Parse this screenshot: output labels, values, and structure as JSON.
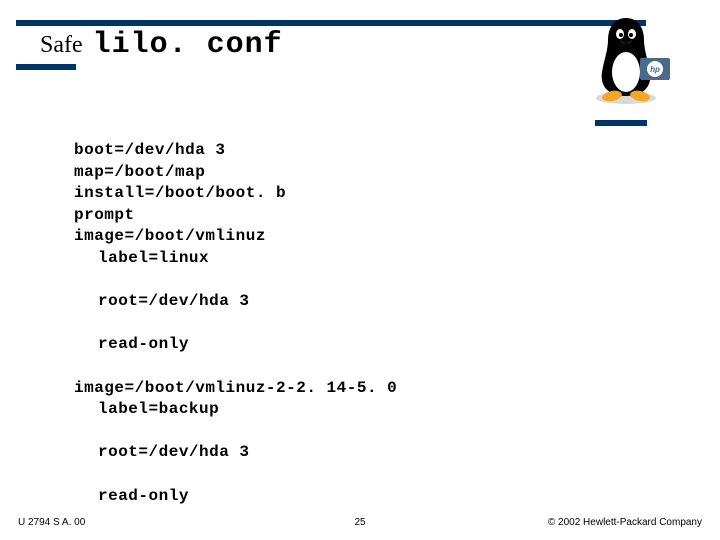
{
  "header": {
    "prefix": "Safe",
    "title": "lilo. conf"
  },
  "config": {
    "lines": [
      {
        "text": "boot=/dev/hda 3",
        "indent": false
      },
      {
        "text": "map=/boot/map",
        "indent": false
      },
      {
        "text": "install=/boot/boot. b",
        "indent": false
      },
      {
        "text": "prompt",
        "indent": false
      },
      {
        "text": "image=/boot/vmlinuz",
        "indent": false
      },
      {
        "text": "label=linux",
        "indent": true
      },
      {
        "text": "root=/dev/hda 3",
        "indent": true
      },
      {
        "text": "read-only",
        "indent": true
      },
      {
        "text": "image=/boot/vmlinuz-2-2. 14-5. 0",
        "indent": false
      },
      {
        "text": "label=backup",
        "indent": true
      },
      {
        "text": "root=/dev/hda 3",
        "indent": true
      },
      {
        "text": "read-only",
        "indent": true
      }
    ]
  },
  "footer": {
    "left": "U 2794 S A. 00",
    "center": "25",
    "right": "© 2002 Hewlett-Packard Company"
  },
  "icons": {
    "mascot": "tux-penguin-icon",
    "badge": "hp-logo-icon"
  }
}
